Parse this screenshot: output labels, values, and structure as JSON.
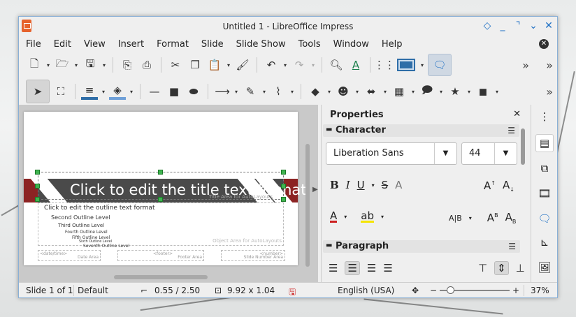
{
  "window": {
    "title": "Untitled 1 - LibreOffice Impress"
  },
  "window_controls": [
    "◇",
    "_",
    "⌝",
    "⌄",
    "✕"
  ],
  "menu": [
    "File",
    "Edit",
    "View",
    "Insert",
    "Format",
    "Slide",
    "Slide Show",
    "Tools",
    "Window",
    "Help"
  ],
  "slide": {
    "title_text": "Click to edit the title text format",
    "title_area_label": "Title Area for AutoLayouts",
    "outline": [
      "Click to edit the outline text format",
      "Second Outline Level",
      "Third Outline Level",
      "Fourth Outline Level",
      "Fifth Outline Level",
      "Sixth Outline Level",
      "Seventh Outline Level"
    ],
    "object_area_label": "Object Area for AutoLayouts",
    "date_field": "<date/time>",
    "date_area_label": "Date Area",
    "footer_field": "<footer>",
    "footer_area_label": "Footer Area",
    "number_field": "<number>",
    "number_area_label": "Slide Number Area"
  },
  "properties": {
    "title": "Properties",
    "character_section": "Character",
    "font_name": "Liberation Sans",
    "font_size": "44",
    "paragraph_section": "Paragraph"
  },
  "status": {
    "slide": "Slide 1 of 1",
    "layout": "Default",
    "position": "0.55 / 2.50",
    "size": "9.92 x 1.04",
    "language": "English (USA)",
    "zoom_minus": "−",
    "zoom_plus": "+",
    "zoom": "37%"
  },
  "colors": {
    "font_color": "#cc2020",
    "highlight": "#f5e400",
    "accent": "#1d6fc4",
    "title_band": "#8c2323"
  }
}
